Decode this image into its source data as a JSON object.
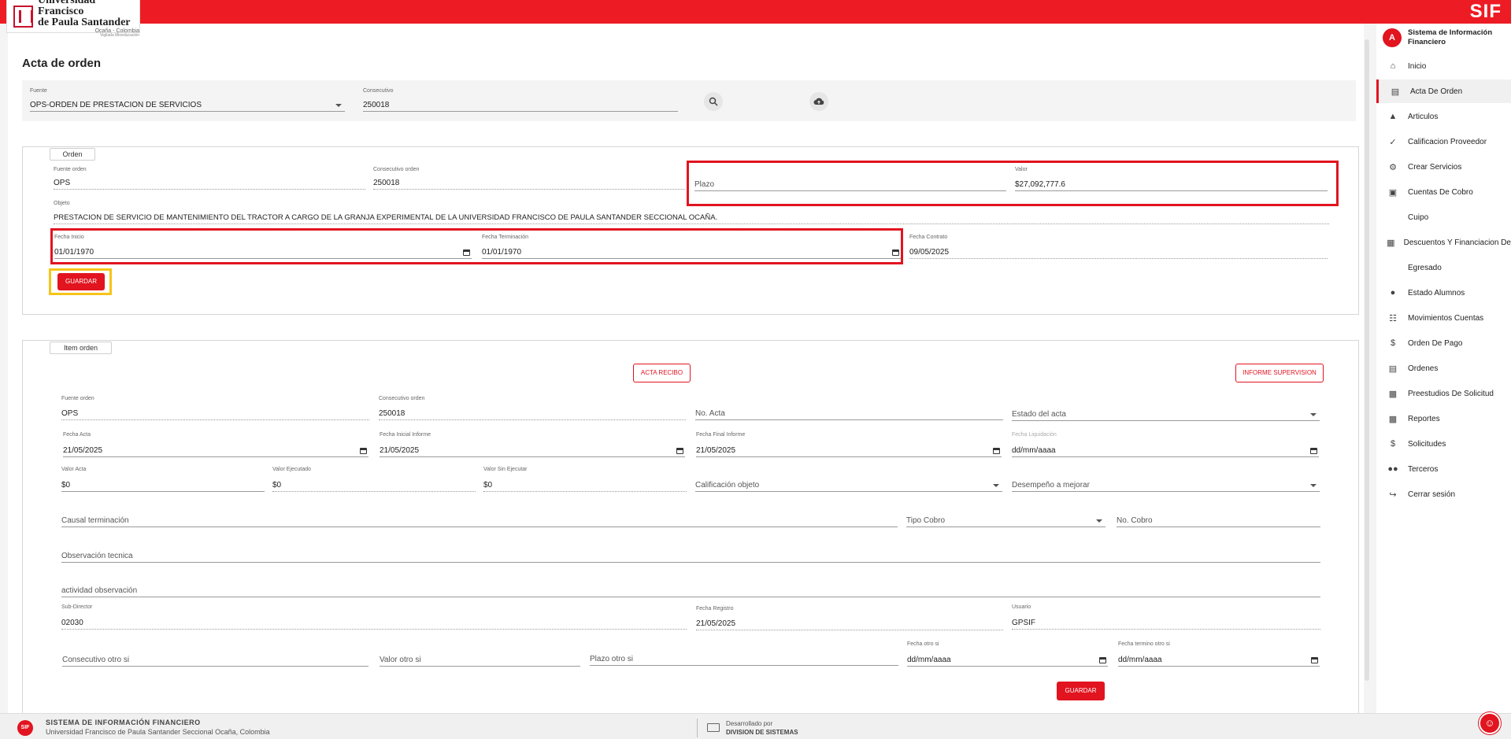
{
  "header": {
    "logo_line1": "Universidad Francisco",
    "logo_line2": "de Paula Santander",
    "logo_line3": "Ocaña - Colombia",
    "logo_line4": "Vigilada Mineducación",
    "brand": "SIF",
    "accent_color": "#ed1c24"
  },
  "page": {
    "title": "Acta de orden"
  },
  "filter": {
    "fuente": {
      "label": "Fuente",
      "value": "OPS-ORDEN DE PRESTACION DE SERVICIOS"
    },
    "consecutivo": {
      "label": "Consecutivo",
      "value": "250018"
    },
    "search_icon": "search-icon",
    "upload_icon": "cloud-upload-icon"
  },
  "orden": {
    "tab": "Orden",
    "fuente_orden": {
      "label": "Fuente orden",
      "value": "OPS"
    },
    "consecutivo_orden": {
      "label": "Consecutivo orden",
      "value": "250018"
    },
    "plazo": {
      "placeholder": "Plazo"
    },
    "valor": {
      "label": "Valor",
      "value": "$27,092,777.6"
    },
    "objeto": {
      "label": "Objeto",
      "value": "PRESTACION DE SERVICIO DE MANTENIMIENTO DEL TRACTOR A CARGO DE LA GRANJA EXPERIMENTAL DE LA UNIVERSIDAD FRANCISCO DE PAULA SANTANDER SECCIONAL OCAÑA."
    },
    "fecha_inicio": {
      "label": "Fecha Inicio",
      "value": "01/01/1970"
    },
    "fecha_terminacion": {
      "label": "Fecha Terminación",
      "value": "01/01/1970"
    },
    "fecha_contrato": {
      "label": "Fecha Contrato",
      "value": "09/05/2025"
    },
    "guardar": "GUARDAR"
  },
  "item": {
    "tab": "Item orden",
    "acta_recibo": "ACTA RECIBO",
    "informe_supervision": "INFORME SUPERVISION",
    "fuente_orden": {
      "label": "Fuente orden",
      "value": "OPS"
    },
    "consecutivo_orden": {
      "label": "Consecutivo orden",
      "value": "250018"
    },
    "no_acta": {
      "placeholder": "No. Acta"
    },
    "estado_acta": {
      "placeholder": "Estado del acta"
    },
    "fecha_acta": {
      "label": "Fecha Acta",
      "value": "21/05/2025"
    },
    "fecha_inicial_informe": {
      "label": "Fecha Inicial Informe",
      "value": "21/05/2025"
    },
    "fecha_final_informe": {
      "label": "Fecha Final Informe",
      "value": "21/05/2025"
    },
    "fecha_liquidacion": {
      "label": "Fecha Liquidación",
      "value": "dd/mm/aaaa"
    },
    "valor_acta": {
      "label": "Valor Acta",
      "value": "$0"
    },
    "valor_ejecutado": {
      "label": "Valor Ejecutado",
      "value": "$0"
    },
    "valor_sin_ejecutar": {
      "label": "Valor Sin Ejecutar",
      "value": "$0"
    },
    "calificacion_objeto": {
      "placeholder": "Calificación objeto"
    },
    "desempeno": {
      "placeholder": "Desempeño a mejorar"
    },
    "causal_terminacion": {
      "placeholder": "Causal terminación"
    },
    "tipo_cobro": {
      "placeholder": "Tipo Cobro"
    },
    "no_cobro": {
      "placeholder": "No. Cobro"
    },
    "observacion_tecnica": {
      "placeholder": "Observación tecnica"
    },
    "actividad_observacion": {
      "placeholder": "actividad observación"
    },
    "sub_director": {
      "label": "Sub-Director",
      "value": "02030"
    },
    "fecha_registro": {
      "label": "Fecha Registro",
      "value": "21/05/2025"
    },
    "usuario": {
      "label": "Usuario",
      "value": "GPSIF"
    },
    "consecutivo_otro_si": {
      "placeholder": "Consecutivo otro si"
    },
    "valor_otro_si": {
      "placeholder": "Valor otro si"
    },
    "plazo_otro_si": {
      "placeholder": "Plazo otro si"
    },
    "fecha_otro_si": {
      "label": "Fecha otro si",
      "value": "dd/mm/aaaa"
    },
    "fecha_termino_otro_si": {
      "label": "Fecha termino otro si",
      "value": "dd/mm/aaaa"
    },
    "guardar": "GUARDAR"
  },
  "sidebar": {
    "avatar": "A",
    "title": "Sistema de Información Financiero",
    "items": [
      {
        "label": "Inicio",
        "icon": "home-icon"
      },
      {
        "label": "Acta De Orden",
        "icon": "document-icon"
      },
      {
        "label": "Articulos",
        "icon": "shapes-icon"
      },
      {
        "label": "Calificacion Proveedor",
        "icon": "rating-icon"
      },
      {
        "label": "Crear Servicios",
        "icon": "gears-icon"
      },
      {
        "label": "Cuentas De Cobro",
        "icon": "bill-icon"
      },
      {
        "label": "Cuipo",
        "icon": ""
      },
      {
        "label": "Descuentos Y Financiacion De",
        "icon": "card-icon"
      },
      {
        "label": "Egresado",
        "icon": ""
      },
      {
        "label": "Estado Alumnos",
        "icon": "person-icon"
      },
      {
        "label": "Movimientos Cuentas",
        "icon": "tree-icon"
      },
      {
        "label": "Orden De Pago",
        "icon": "dollar-doc-icon"
      },
      {
        "label": "Ordenes",
        "icon": "file-icon"
      },
      {
        "label": "Preestudios De Solicitud",
        "icon": "chart-icon"
      },
      {
        "label": "Reportes",
        "icon": "report-icon"
      },
      {
        "label": "Solicitudes",
        "icon": "dollar-doc-icon"
      },
      {
        "label": "Terceros",
        "icon": "group-icon"
      },
      {
        "label": "Cerrar sesión",
        "icon": "logout-icon"
      }
    ]
  },
  "footer": {
    "logo": "SIF",
    "line1": "SISTEMA DE INFORMACIÓN FINANCIERO",
    "line2": "Universidad Francisco de Paula Santander Seccional Ocaña, Colombia",
    "dev_line1": "Desarrollado por",
    "dev_line2": "DIVISION DE SISTEMAS"
  }
}
